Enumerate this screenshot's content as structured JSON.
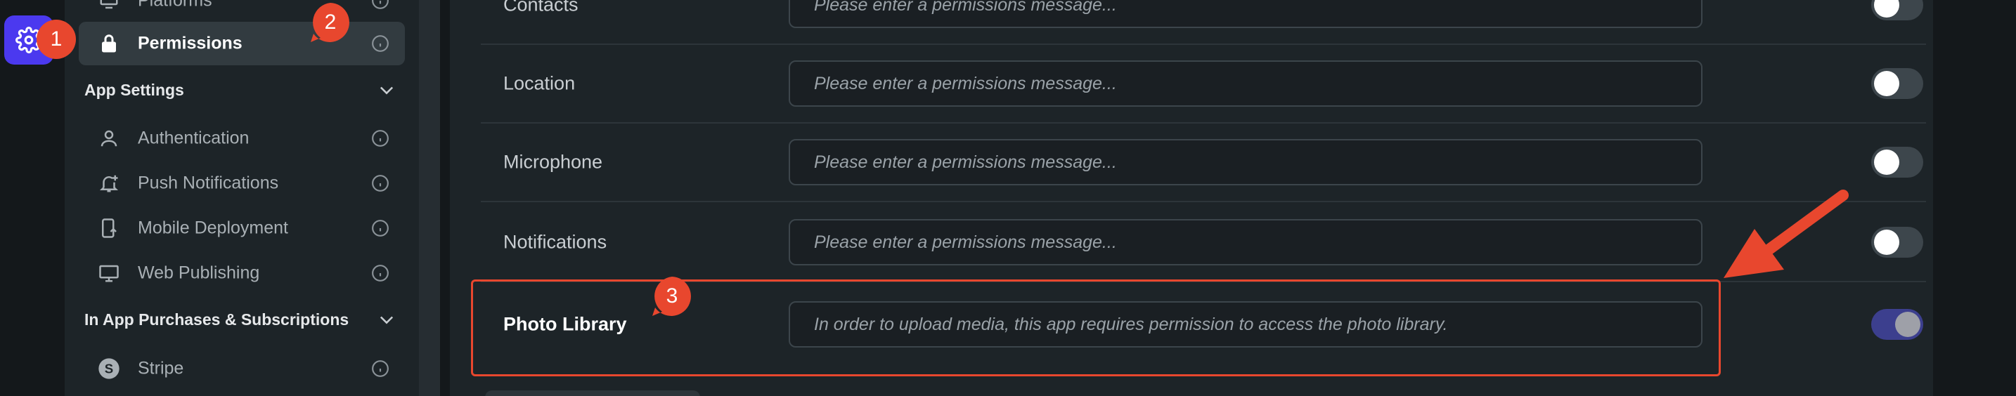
{
  "sidebar": {
    "platforms_label": "Platforms",
    "permissions_label": "Permissions",
    "app_settings": {
      "title": "App Settings",
      "items": [
        {
          "label": "Authentication"
        },
        {
          "label": "Push Notifications"
        },
        {
          "label": "Mobile Deployment"
        },
        {
          "label": "Web Publishing"
        }
      ]
    },
    "purchases": {
      "title": "In App Purchases & Subscriptions",
      "items": [
        {
          "label": "Stripe"
        }
      ]
    }
  },
  "permissions": {
    "rows": [
      {
        "label": "Contacts",
        "placeholder": "Please enter a permissions message...",
        "value": "",
        "enabled": false
      },
      {
        "label": "Location",
        "placeholder": "Please enter a permissions message...",
        "value": "",
        "enabled": false
      },
      {
        "label": "Microphone",
        "placeholder": "Please enter a permissions message...",
        "value": "",
        "enabled": false
      },
      {
        "label": "Notifications",
        "placeholder": "Please enter a permissions message...",
        "value": "",
        "enabled": false
      },
      {
        "label": "Photo Library",
        "placeholder": "",
        "value": "In order to upload media, this app requires permission to access the photo library.",
        "enabled": true
      }
    ]
  },
  "annotations": {
    "badge_1": "1",
    "badge_2": "2",
    "badge_3": "3",
    "accent_color": "#e8472e"
  },
  "colors": {
    "brand": "#4b39ef",
    "toggle_on": "#3c3f8e"
  }
}
